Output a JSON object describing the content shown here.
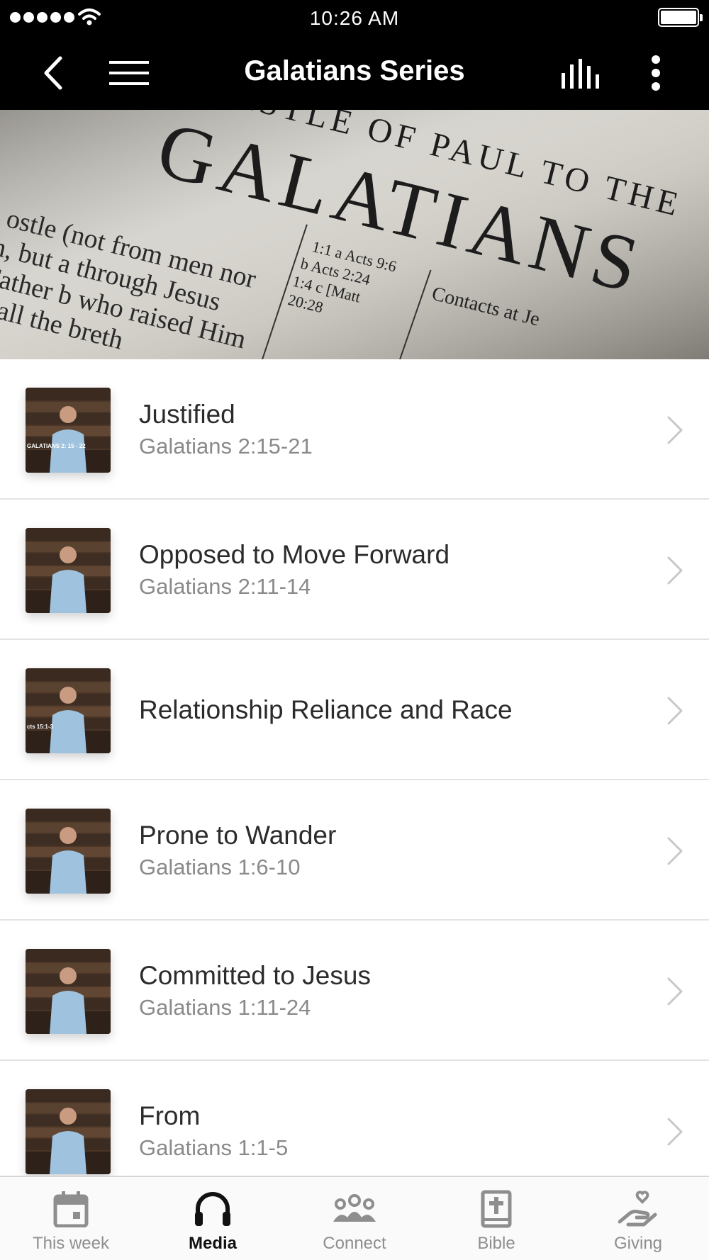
{
  "status_bar": {
    "time": "10:26 AM"
  },
  "nav": {
    "title": "Galatians Series"
  },
  "banner": {
    "heading_top": "ISTLE OF PAUL TO THE",
    "heading_main": "GALATIANS",
    "body_lines": [
      "ostle (not from men nor",
      "n, but a through Jesus",
      "Father b who raised Him",
      "d all the breth"
    ],
    "cross_refs": [
      "1:1  a Acts 9:6",
      "b Acts 2:24",
      "1:4  c [Matt",
      "20:28"
    ],
    "section_heading": "Contacts at Je"
  },
  "sermons": [
    {
      "title": "Justified",
      "subtitle": "Galatians 2:15-21",
      "thumb_caption": "GALATIANS 2: 15 - 22"
    },
    {
      "title": "Opposed to Move Forward",
      "subtitle": "Galatians 2:11-14",
      "thumb_caption": ""
    },
    {
      "title": "Relationship Reliance and Race",
      "subtitle": "",
      "thumb_caption": "cts 15:1-3"
    },
    {
      "title": "Prone to Wander",
      "subtitle": "Galatians 1:6-10",
      "thumb_caption": ""
    },
    {
      "title": "Committed to Jesus",
      "subtitle": "Galatians 1:11-24",
      "thumb_caption": ""
    },
    {
      "title": "From",
      "subtitle": "Galatians 1:1-5",
      "thumb_caption": ""
    }
  ],
  "tabs": [
    {
      "label": "This week",
      "icon": "calendar-icon"
    },
    {
      "label": "Media",
      "icon": "headphones-icon"
    },
    {
      "label": "Connect",
      "icon": "people-icon"
    },
    {
      "label": "Bible",
      "icon": "bible-icon"
    },
    {
      "label": "Giving",
      "icon": "giving-hand-icon"
    }
  ],
  "colors": {
    "bar_background": "#000000",
    "chevron": "#c7c7cc",
    "subtitle": "#8a8a8a",
    "tab_inactive": "#8e8e8e",
    "tab_active": "#111111"
  }
}
